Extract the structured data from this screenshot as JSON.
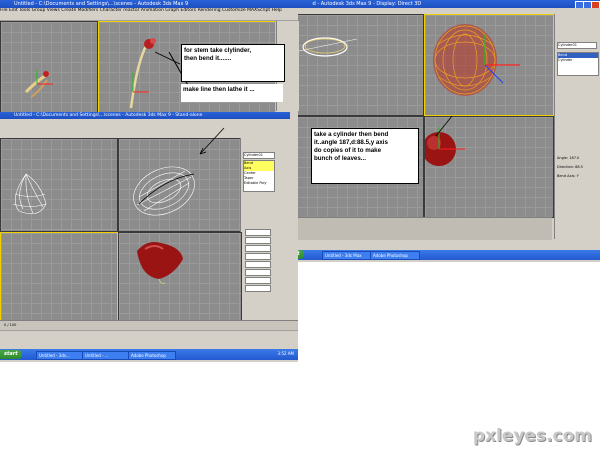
{
  "left_window": {
    "title": "Untitled - C:\\Documents and Settings\\...\\scenes - Autodesk 3ds Max 9",
    "title_bottom": "Untitled - C:\\Documents and Settings\\...\\scenes - Autodesk 3ds Max 9 - Stand-alone",
    "menu": [
      "File",
      "Edit",
      "Tools",
      "Group",
      "Views",
      "Create",
      "Modifiers",
      "Character",
      "reactor",
      "Animation",
      "Graph Editors",
      "Rendering",
      "Customize",
      "MAXScript",
      "Help"
    ],
    "viewports": [
      "Top",
      "Front",
      "Left",
      "Perspective"
    ],
    "command_panel": {
      "object_field": "Cylinder01",
      "items": [
        "Bend",
        "Axis",
        "Center",
        "Taper",
        "Editable Poly"
      ]
    },
    "timeline": {
      "frame": "0 / 100"
    },
    "taskbar": {
      "start": "start",
      "tasks": [
        "Untitled - 3ds...",
        "Untitled - ...",
        "Adobe Photoshop"
      ],
      "clock": "3:52 AM"
    }
  },
  "right_window": {
    "title": "Untitled - Autodesk 3ds Max 9 - Display: Direct 3D",
    "command_panel": {
      "object_field": "Cylinder01",
      "items": [
        "Bend",
        "Cylinder"
      ],
      "params": [
        "Angle: 187.0",
        "Direction: 88.5",
        "Bend Axis: Y"
      ]
    },
    "taskbar": {
      "start": "start",
      "tasks": [
        "Untitled - 3ds Max",
        "Adobe Photoshop"
      ]
    }
  },
  "notes": {
    "stem": "for stem take clylinder,\nthen bend it.......",
    "lathe": "make line then lathe it ...",
    "leaves": "take a cylinder then bend\nit..angle 187,d:88.5,y axis\ndo copies of it to make\nbunch of leaves..."
  },
  "watermark": "pxleyes.com",
  "colors": {
    "title_bar": "#2a62d8",
    "viewport_bg": "#8c8c8c",
    "active_border": "#f0d000",
    "flower_red": "#a01818"
  }
}
